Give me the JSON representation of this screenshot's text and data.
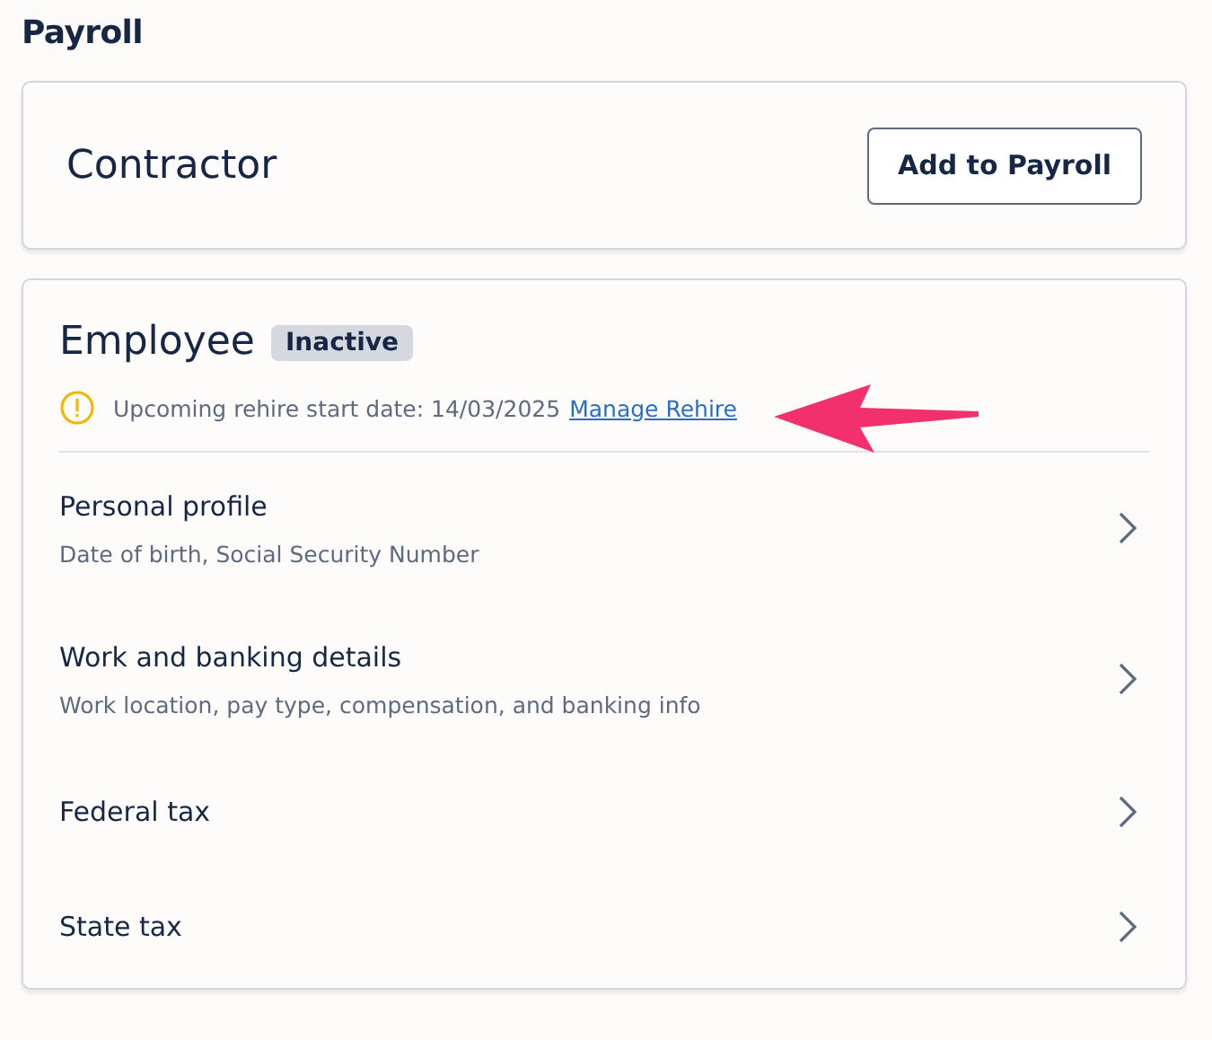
{
  "page_title": "Payroll",
  "contractor": {
    "title": "Contractor",
    "button": "Add to Payroll"
  },
  "employee": {
    "title": "Employee",
    "status": "Inactive",
    "notice": {
      "text": "Upcoming rehire start date: 14/03/2025",
      "link": "Manage Rehire"
    },
    "sections": [
      {
        "title": "Personal profile",
        "subtitle": "Date of birth, Social Security Number"
      },
      {
        "title": "Work and banking details",
        "subtitle": "Work location, pay type, compensation, and banking info"
      },
      {
        "title": "Federal tax"
      },
      {
        "title": "State tax"
      }
    ]
  }
}
